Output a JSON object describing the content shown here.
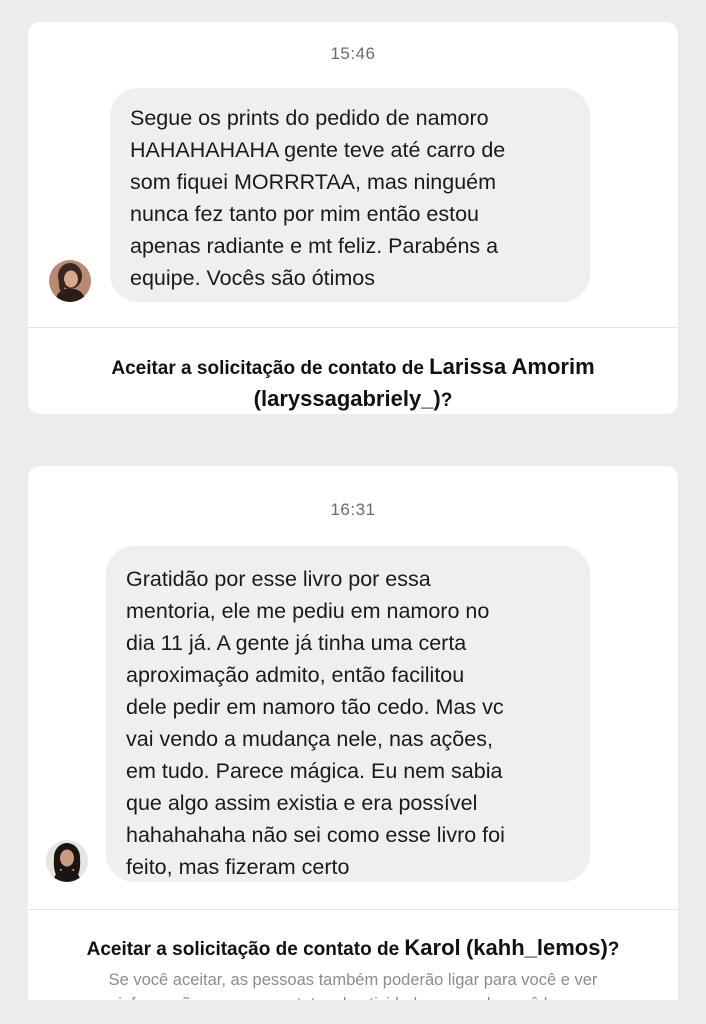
{
  "cards": [
    {
      "time": "15:46",
      "message_lines": [
        "Segue os prints do pedido de namoro",
        "HAHAHAHAHA gente teve até carro de",
        "som fiquei MORRRTAA, mas ninguém",
        "nunca fez tanto por mim então estou",
        "apenas radiante e mt feliz. Parabéns a",
        "equipe. Vocês são ótimos"
      ],
      "prompt_prefix": "Aceitar a solicitação de contato de",
      "contact_name": "Larissa Amorim",
      "contact_handle": "(laryssagabriely_)",
      "prompt_suffix": "?"
    },
    {
      "time": "16:31",
      "message_lines": [
        "Gratidão por esse livro por essa",
        "mentoria, ele me pediu em namoro no",
        "dia 11 já. A gente já tinha uma certa",
        "aproximação admito, então facilitou",
        "dele pedir em namoro tão cedo. Mas vc",
        "vai vendo a mudança nele, nas ações,",
        "em tudo. Parece mágica. Eu nem sabia",
        "que algo assim existia e era possível",
        "hahahahaha não sei como esse livro foi",
        "feito, mas fizeram certo"
      ],
      "prompt_prefix": "Aceitar a solicitação de contato de",
      "contact_name": "Karol",
      "contact_handle": "(kahh_lemos)",
      "prompt_suffix": "?",
      "subtext_lines": [
        "Se você aceitar, as pessoas também poderão ligar para você e ver",
        "informações como seu status de atividade e quando você leu as"
      ]
    }
  ]
}
